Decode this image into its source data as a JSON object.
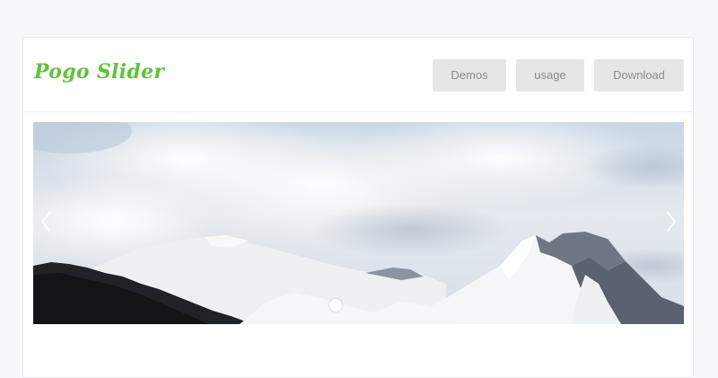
{
  "header": {
    "logo_text": "Pogo Slider",
    "nav": [
      {
        "label": "Demos"
      },
      {
        "label": "usage"
      },
      {
        "label": "Download"
      }
    ]
  },
  "slider": {
    "image_subject": "snowy-mountains",
    "active_slide": 1,
    "slide_count": 1
  },
  "colors": {
    "background": "#f6f7f9",
    "logo": "#5fc43a",
    "button_bg": "#e6e6e6",
    "button_text": "#8a8a8a"
  }
}
